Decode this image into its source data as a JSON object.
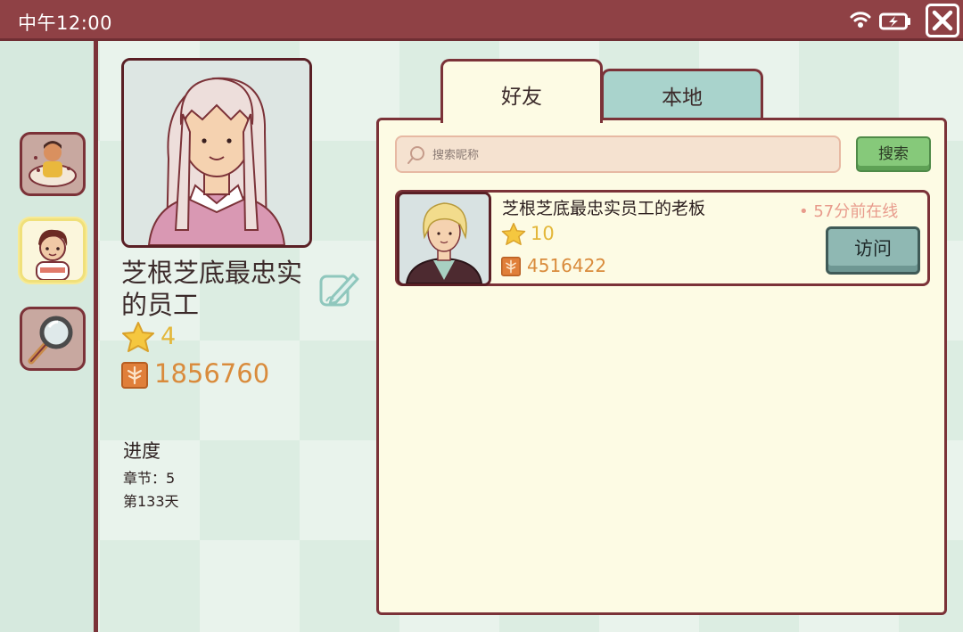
{
  "status_bar": {
    "time": "中午12:00",
    "wifi_icon": "wifi-icon",
    "battery_icon": "battery-charging-icon",
    "close_icon": "close-x-icon"
  },
  "sidebar": {
    "items": [
      {
        "name": "characters",
        "icon": "character-stack-icon",
        "active": false
      },
      {
        "name": "profile",
        "icon": "player-avatar-icon",
        "active": true
      },
      {
        "name": "search",
        "icon": "magnifier-icon",
        "active": false
      }
    ]
  },
  "profile": {
    "name": "芝根芝底最忠实的员工",
    "level": "4",
    "coins": "1856760",
    "progress_title": "进度",
    "chapter": "章节：5",
    "day": "第133天",
    "edit_icon": "pencil-edit-icon"
  },
  "tabs": [
    {
      "label": "好友",
      "active": true
    },
    {
      "label": "本地",
      "active": false
    }
  ],
  "search": {
    "placeholder": "搜索昵称",
    "button_label": "搜索"
  },
  "friends": [
    {
      "name": "芝根芝底最忠实员工的老板",
      "status": "• 57分前在线",
      "level": "10",
      "coins": "4516422",
      "button_label": "访问"
    }
  ],
  "colors": {
    "status_bar": "#8f4145",
    "border": "#7b3238",
    "panel": "#fdfbe4",
    "level_gold": "#e3b73a",
    "coins_orange": "#d98b3c",
    "search_button": "#86c97a",
    "visit_button": "#8fb8b3",
    "tab_inactive": "#a9d3cc"
  }
}
